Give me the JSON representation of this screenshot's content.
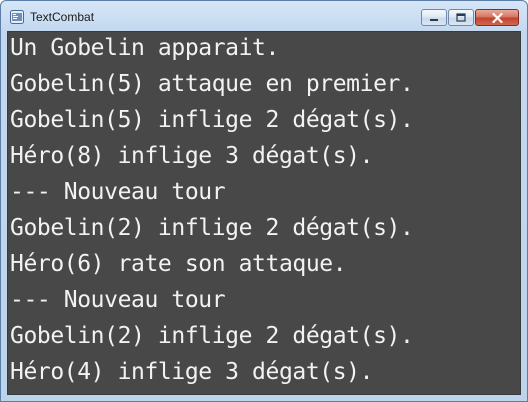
{
  "window": {
    "title": "TextCombat"
  },
  "console": {
    "lines": [
      "Un Gobelin apparait.",
      "Gobelin(5) attaque en premier.",
      "Gobelin(5) inflige 2 dégat(s).",
      "Héro(8) inflige 3 dégat(s).",
      "--- Nouveau tour",
      "Gobelin(2) inflige 2 dégat(s).",
      "Héro(6) rate son attaque.",
      "--- Nouveau tour",
      "Gobelin(2) inflige 2 dégat(s).",
      "Héro(4) inflige 3 dégat(s)."
    ]
  },
  "icons": {
    "app": "app-window-icon",
    "minimize": "minimize-icon",
    "maximize": "maximize-icon",
    "close": "close-icon"
  },
  "colors": {
    "console_background": "#484848",
    "console_text": "#f2f2f2",
    "close_button": "#c7432f"
  }
}
